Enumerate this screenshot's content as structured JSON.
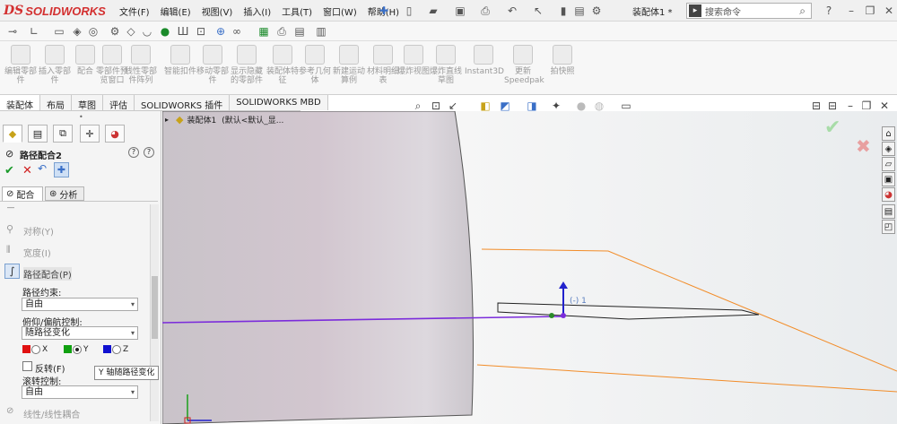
{
  "app": {
    "logo_mark": "DS",
    "logo_text": "SOLIDWORKS",
    "doc_title": "装配体1 *"
  },
  "menu": [
    "文件(F)",
    "编辑(E)",
    "视图(V)",
    "插入(I)",
    "工具(T)",
    "窗口(W)",
    "帮助(H)"
  ],
  "search": {
    "placeholder": "搜索命令"
  },
  "ribbon": [
    {
      "label": "编辑零部件",
      "icon": "edit-component-icon"
    },
    {
      "label": "插入零部件",
      "icon": "insert-component-icon"
    },
    {
      "label": "配合",
      "icon": "mate-icon"
    },
    {
      "label": "零部件预览窗口",
      "icon": "component-preview-icon"
    },
    {
      "label": "线性零部件阵列",
      "icon": "linear-pattern-icon"
    },
    {
      "label": "智能扣件",
      "icon": "smart-fastener-icon"
    },
    {
      "label": "移动零部件",
      "icon": "move-component-icon"
    },
    {
      "label": "显示隐藏的零部件",
      "icon": "show-hidden-icon"
    },
    {
      "label": "装配体特征",
      "icon": "assembly-feature-icon"
    },
    {
      "label": "参考几何体",
      "icon": "reference-geometry-icon"
    },
    {
      "label": "新建运动算例",
      "icon": "motion-study-icon"
    },
    {
      "label": "材料明细表",
      "icon": "bom-icon"
    },
    {
      "label": "爆炸视图",
      "icon": "exploded-view-icon"
    },
    {
      "label": "爆炸直线草图",
      "icon": "explode-line-icon"
    },
    {
      "label": "Instant3D",
      "icon": "instant3d-icon"
    },
    {
      "label": "更新Speedpak",
      "icon": "speedpak-icon"
    },
    {
      "label": "拍快照",
      "icon": "snapshot-icon"
    }
  ],
  "command_tabs": [
    "装配体",
    "布局",
    "草图",
    "评估",
    "SOLIDWORKS 插件",
    "SOLIDWORKS MBD"
  ],
  "property_manager": {
    "title": "路径配合2",
    "tabs": [
      "配合",
      "分析"
    ],
    "mate_options": [
      "对称(Y)",
      "宽度(I)",
      "路径配合(P)"
    ],
    "path_constraint_label": "路径约束:",
    "path_constraint_value": "自由",
    "pitch_yaw_label": "俯仰/偏航控制:",
    "pitch_yaw_value": "随路径变化",
    "axes": [
      {
        "label": "X",
        "color": "#e01010"
      },
      {
        "label": "Y",
        "color": "#10a010"
      },
      {
        "label": "Z",
        "color": "#1010d0"
      }
    ],
    "flip_label": "反转(F)",
    "roll_label": "滚转控制:",
    "roll_value": "自由",
    "bottom_option": "线性/线性耦合"
  },
  "tooltip": "Y 轴随路径变化",
  "tree": {
    "root": "装配体1",
    "config": "(默认<默认_显..."
  },
  "viewport": {
    "small_label": "(-) 1",
    "accent": "#7b2cdb",
    "plane_color": "#f28c28"
  }
}
